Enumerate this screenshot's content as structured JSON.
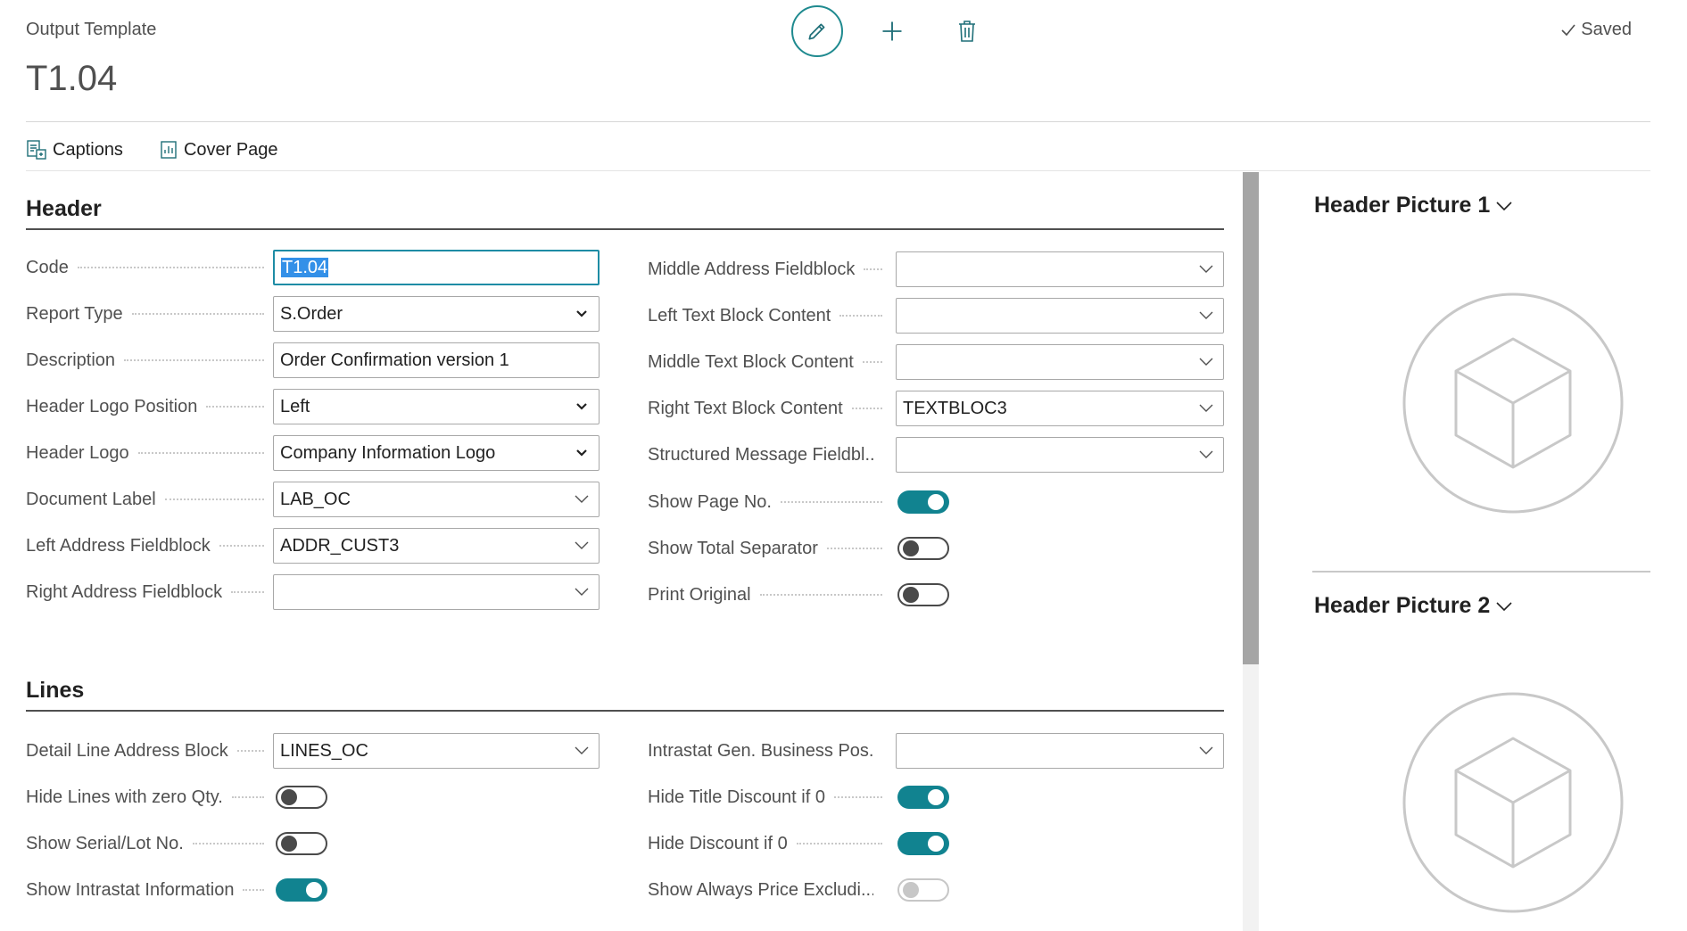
{
  "page": {
    "caption": "Output Template",
    "title": "T1.04",
    "status": "Saved"
  },
  "actionbar": {
    "captions": "Captions",
    "cover_page": "Cover Page"
  },
  "header": {
    "title": "Header",
    "left_fields": [
      {
        "label": "Code",
        "value": "T1.04"
      },
      {
        "label": "Report Type",
        "value": "S.Order"
      },
      {
        "label": "Description",
        "value": "Order Confirmation version 1"
      },
      {
        "label": "Header Logo Position",
        "value": "Left"
      },
      {
        "label": "Header Logo",
        "value": "Company Information Logo"
      },
      {
        "label": "Document Label",
        "value": "LAB_OC"
      },
      {
        "label": "Left Address Fieldblock",
        "value": "ADDR_CUST3"
      },
      {
        "label": "Right Address Fieldblock",
        "value": ""
      }
    ],
    "right_fields": [
      {
        "label": "Middle Address Fieldblock",
        "value": ""
      },
      {
        "label": "Left Text Block Content",
        "value": ""
      },
      {
        "label": "Middle Text Block Content",
        "value": ""
      },
      {
        "label": "Right Text Block Content",
        "value": "TEXTBLOC3"
      },
      {
        "label": "Structured Message Fieldbl...",
        "value": ""
      },
      {
        "label": "Show Page No.",
        "on": true
      },
      {
        "label": "Show Total Separator",
        "on": false
      },
      {
        "label": "Print Original",
        "on": false
      }
    ]
  },
  "lines": {
    "title": "Lines",
    "left_fields": [
      {
        "label": "Detail Line Address Block",
        "value": "LINES_OC"
      },
      {
        "label": "Hide Lines with zero Qty.",
        "on": false
      },
      {
        "label": "Show Serial/Lot No.",
        "on": false
      },
      {
        "label": "Show Intrastat Information",
        "on": true
      }
    ],
    "right_fields": [
      {
        "label": "Intrastat Gen. Business Pos...",
        "value": ""
      },
      {
        "label": "Hide Title Discount if 0",
        "on": true
      },
      {
        "label": "Hide Discount if 0",
        "on": true
      },
      {
        "label": "Show Always Price Excludi...",
        "on": false,
        "disabled": true
      }
    ]
  },
  "factbox": {
    "picture1_title": "Header Picture 1",
    "picture2_title": "Header Picture 2"
  },
  "colors": {
    "accent": "#118390",
    "focus_border": "#1e8ca5",
    "selection": "#3390e8"
  }
}
